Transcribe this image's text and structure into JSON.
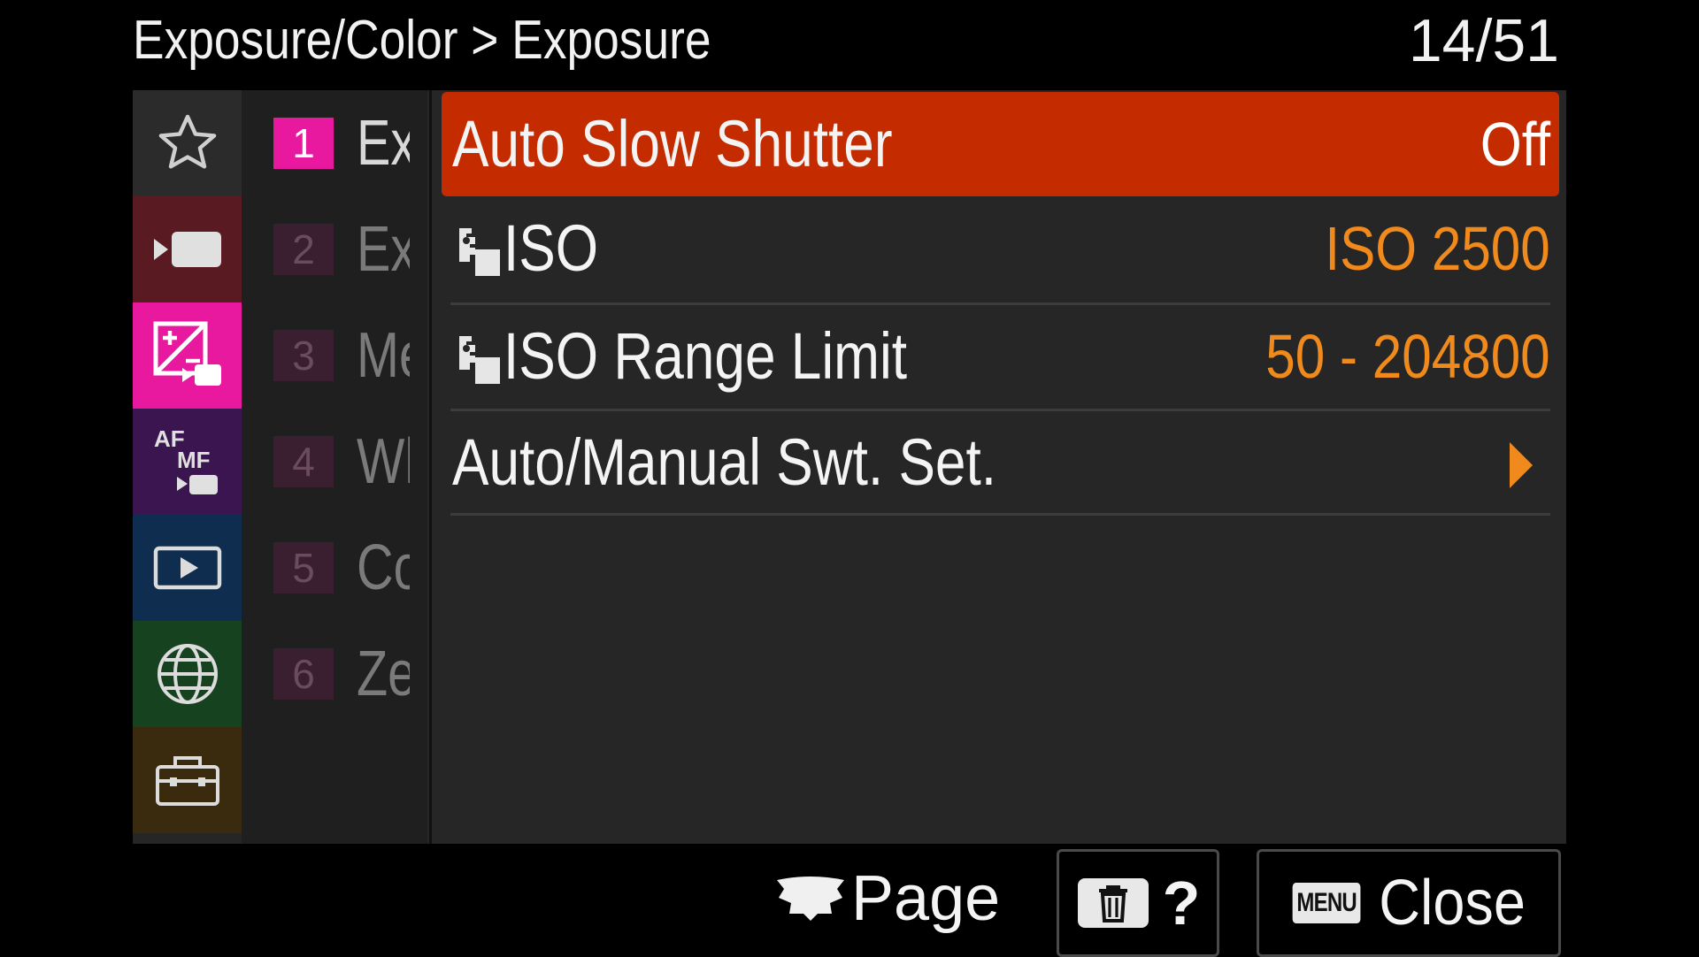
{
  "header": {
    "breadcrumb": "Exposure/Color > Exposure",
    "page_counter": "14/51"
  },
  "categories": [
    {
      "name": "star",
      "icon": "star-icon",
      "color": "#2b2b2b"
    },
    {
      "name": "shooting",
      "icon": "movie-camera-icon",
      "color": "#5a1a22"
    },
    {
      "name": "exposure-color",
      "icon": "exposure-compensation-icon",
      "color": "#e8199f",
      "active": true
    },
    {
      "name": "focus",
      "icon": "af-mf-icon",
      "color": "#3a1550"
    },
    {
      "name": "playback",
      "icon": "playback-icon",
      "color": "#0f2e4f"
    },
    {
      "name": "network",
      "icon": "globe-icon",
      "color": "#17421f"
    },
    {
      "name": "setup",
      "icon": "toolbox-icon",
      "color": "#3a2b0f"
    }
  ],
  "subcategories": [
    {
      "num": "1",
      "label": "Exposure",
      "active": true
    },
    {
      "num": "2",
      "label": "Exposure Comp."
    },
    {
      "num": "3",
      "label": "Metering"
    },
    {
      "num": "4",
      "label": "White Balance"
    },
    {
      "num": "5",
      "label": "Color/Tone"
    },
    {
      "num": "6",
      "label": "Zebra Display"
    }
  ],
  "menu_items": [
    {
      "label": "Auto Slow Shutter",
      "value": "Off",
      "selected": true
    },
    {
      "label": "ISO",
      "value": "ISO 2500",
      "icon": "photo-mode-icon"
    },
    {
      "label": "ISO Range Limit",
      "value": "50 - 204800",
      "icon": "photo-mode-icon"
    },
    {
      "label": "Auto/Manual Swt. Set.",
      "value": "",
      "arrow": true
    }
  ],
  "footer": {
    "page_label": "Page",
    "help_label": "?",
    "menu_badge": "MENU",
    "close_label": "Close"
  },
  "colors": {
    "selected": "#c42c00",
    "value_orange": "#f08a1c",
    "accent_magenta": "#e8199f"
  }
}
